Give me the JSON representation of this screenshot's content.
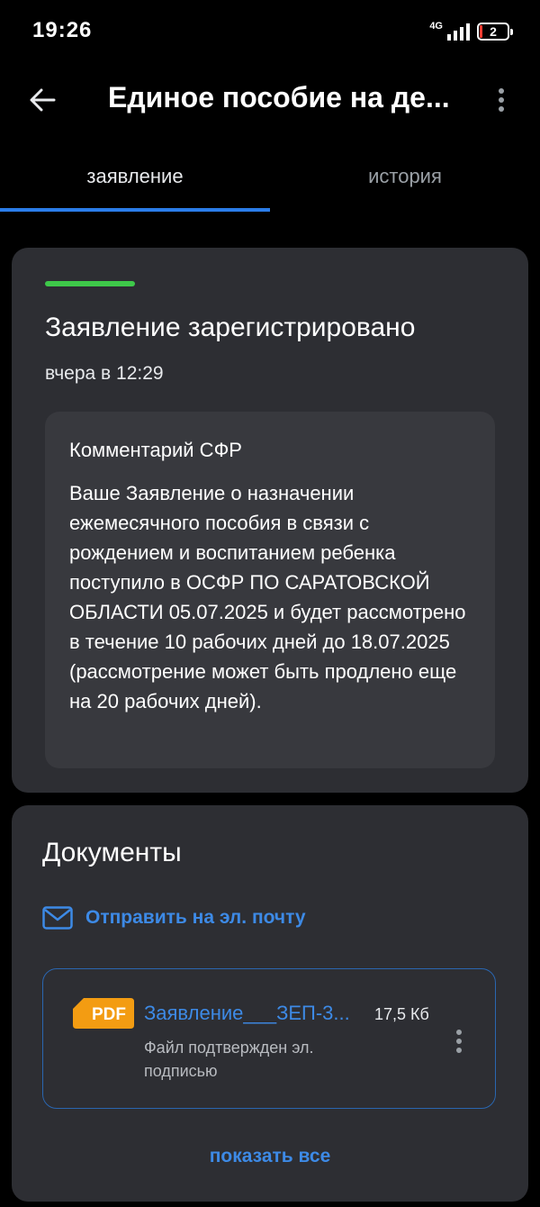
{
  "status_bar": {
    "time": "19:26",
    "network": "4G",
    "battery_level": "2",
    "battery_color": "#ff3b30"
  },
  "app_bar": {
    "title": "Единое пособие на де...",
    "back_icon": "arrow-left-icon",
    "more_icon": "vertical-dots-icon"
  },
  "tabs": [
    {
      "label": "заявление",
      "active": true
    },
    {
      "label": "история",
      "active": false
    }
  ],
  "status_card": {
    "title": "Заявление зарегистрировано",
    "time": "вчера в 12:29",
    "progress_color": "#3ec94a",
    "comment": {
      "heading": "Комментарий СФР",
      "text": "Ваше Заявление о назначении ежемесячного пособия в связи с рождением и воспитанием ребенка поступило в ОСФР ПО САРАТОВСКОЙ ОБЛАСТИ 05.07.2025 и будет рассмотрено в течение 10 рабочих дней до 18.07.2025 (рассмотрение может быть продлено еще на 20 рабочих дней)."
    }
  },
  "documents": {
    "title": "Документы",
    "email_link": "Отправить на эл. почту",
    "email_icon": "envelope-icon",
    "items": [
      {
        "badge": "PDF",
        "name": "Заявление___ЗЕП-3...",
        "size": "17,5 Кб",
        "signed": "Файл подтвержден эл. подписью"
      }
    ],
    "show_all": "показать все"
  },
  "colors": {
    "accent": "#2b7de9",
    "link": "#3d8ae6",
    "card": "#2d2e33",
    "pdf_badge": "#f39c12"
  }
}
